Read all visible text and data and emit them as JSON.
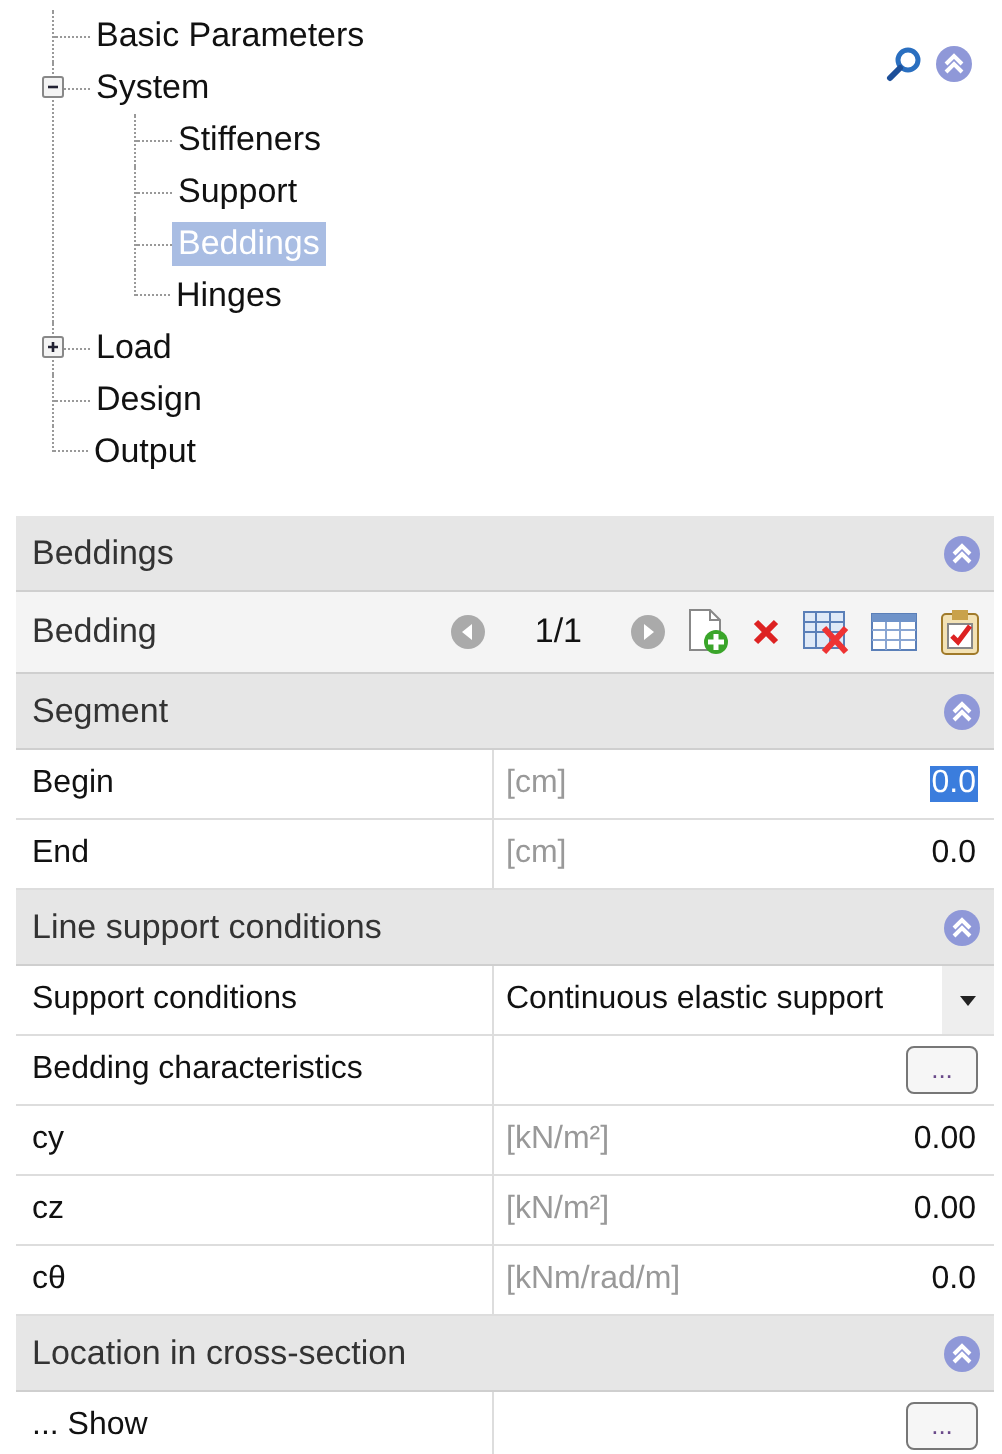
{
  "tree": [
    {
      "label": "Basic Parameters",
      "selected": false
    },
    {
      "label": "System",
      "selected": false,
      "expanded": true,
      "children": [
        {
          "label": "Stiffeners",
          "selected": false
        },
        {
          "label": "Support",
          "selected": false
        },
        {
          "label": "Beddings",
          "selected": true
        },
        {
          "label": "Hinges",
          "selected": false
        }
      ]
    },
    {
      "label": "Load",
      "selected": false,
      "expanded": false
    },
    {
      "label": "Design",
      "selected": false
    },
    {
      "label": "Output",
      "selected": false
    }
  ],
  "panel": {
    "title": "Beddings",
    "expanded": true,
    "record": {
      "label": "Bedding",
      "counter": "1/1"
    },
    "sections": [
      {
        "title": "Segment",
        "expanded": true,
        "rows": [
          {
            "kind": "value",
            "label": "Begin",
            "unit": "[cm]",
            "value": "0.0",
            "selected": true
          },
          {
            "kind": "value",
            "label": "End",
            "unit": "[cm]",
            "value": "0.0",
            "selected": false
          }
        ]
      },
      {
        "title": "Line support conditions",
        "expanded": true,
        "rows": [
          {
            "kind": "dropdown",
            "label": "Support conditions",
            "value": "Continuous elastic support"
          },
          {
            "kind": "button",
            "label": "Bedding characteristics",
            "button": "..."
          },
          {
            "kind": "value",
            "label": "cy",
            "unit": "[kN/m²]",
            "value": "0.00",
            "selected": false
          },
          {
            "kind": "value",
            "label": "cz",
            "unit": "[kN/m²]",
            "value": "0.00",
            "selected": false
          },
          {
            "kind": "value",
            "label": "cθ",
            "unit": "[kNm/rad/m]",
            "value": "0.0",
            "selected": false
          }
        ]
      },
      {
        "title": "Location in cross-section",
        "expanded": true,
        "rows": [
          {
            "kind": "button",
            "label": "... Show",
            "button": "..."
          }
        ]
      }
    ]
  }
}
